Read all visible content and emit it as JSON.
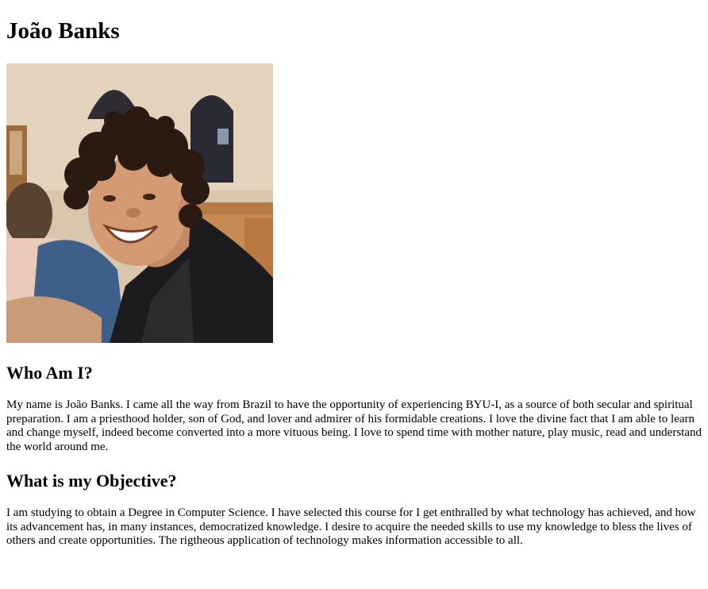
{
  "profile": {
    "name": "João Banks",
    "photo_alt": "Smiling young man with curly hair in a black leather jacket"
  },
  "sections": [
    {
      "heading": "Who Am I?",
      "text": "My name is João Banks. I came all the way from Brazil to have the opportunity of experiencing BYU-I, as a source of both secular and spiritual preparation. I am a priesthood holder, son of God, and lover and admirer of his formidable creations. I love the divine fact that I am able to learn and change myself, indeed become converted into a more vituous being. I love to spend time with mother nature, play music, read and understand the world around me."
    },
    {
      "heading": "What is my Objective?",
      "text": "I am studying to obtain a Degree in Computer Science. I have selected this course for I get enthralled by what technology has achieved, and how its advancement has, in many instances, democratized knowledge. I desire to acquire the needed skills to use my knowledge to bless the lives of others and create opportunities. The rigtheous application of technology makes information accessible to all."
    }
  ]
}
